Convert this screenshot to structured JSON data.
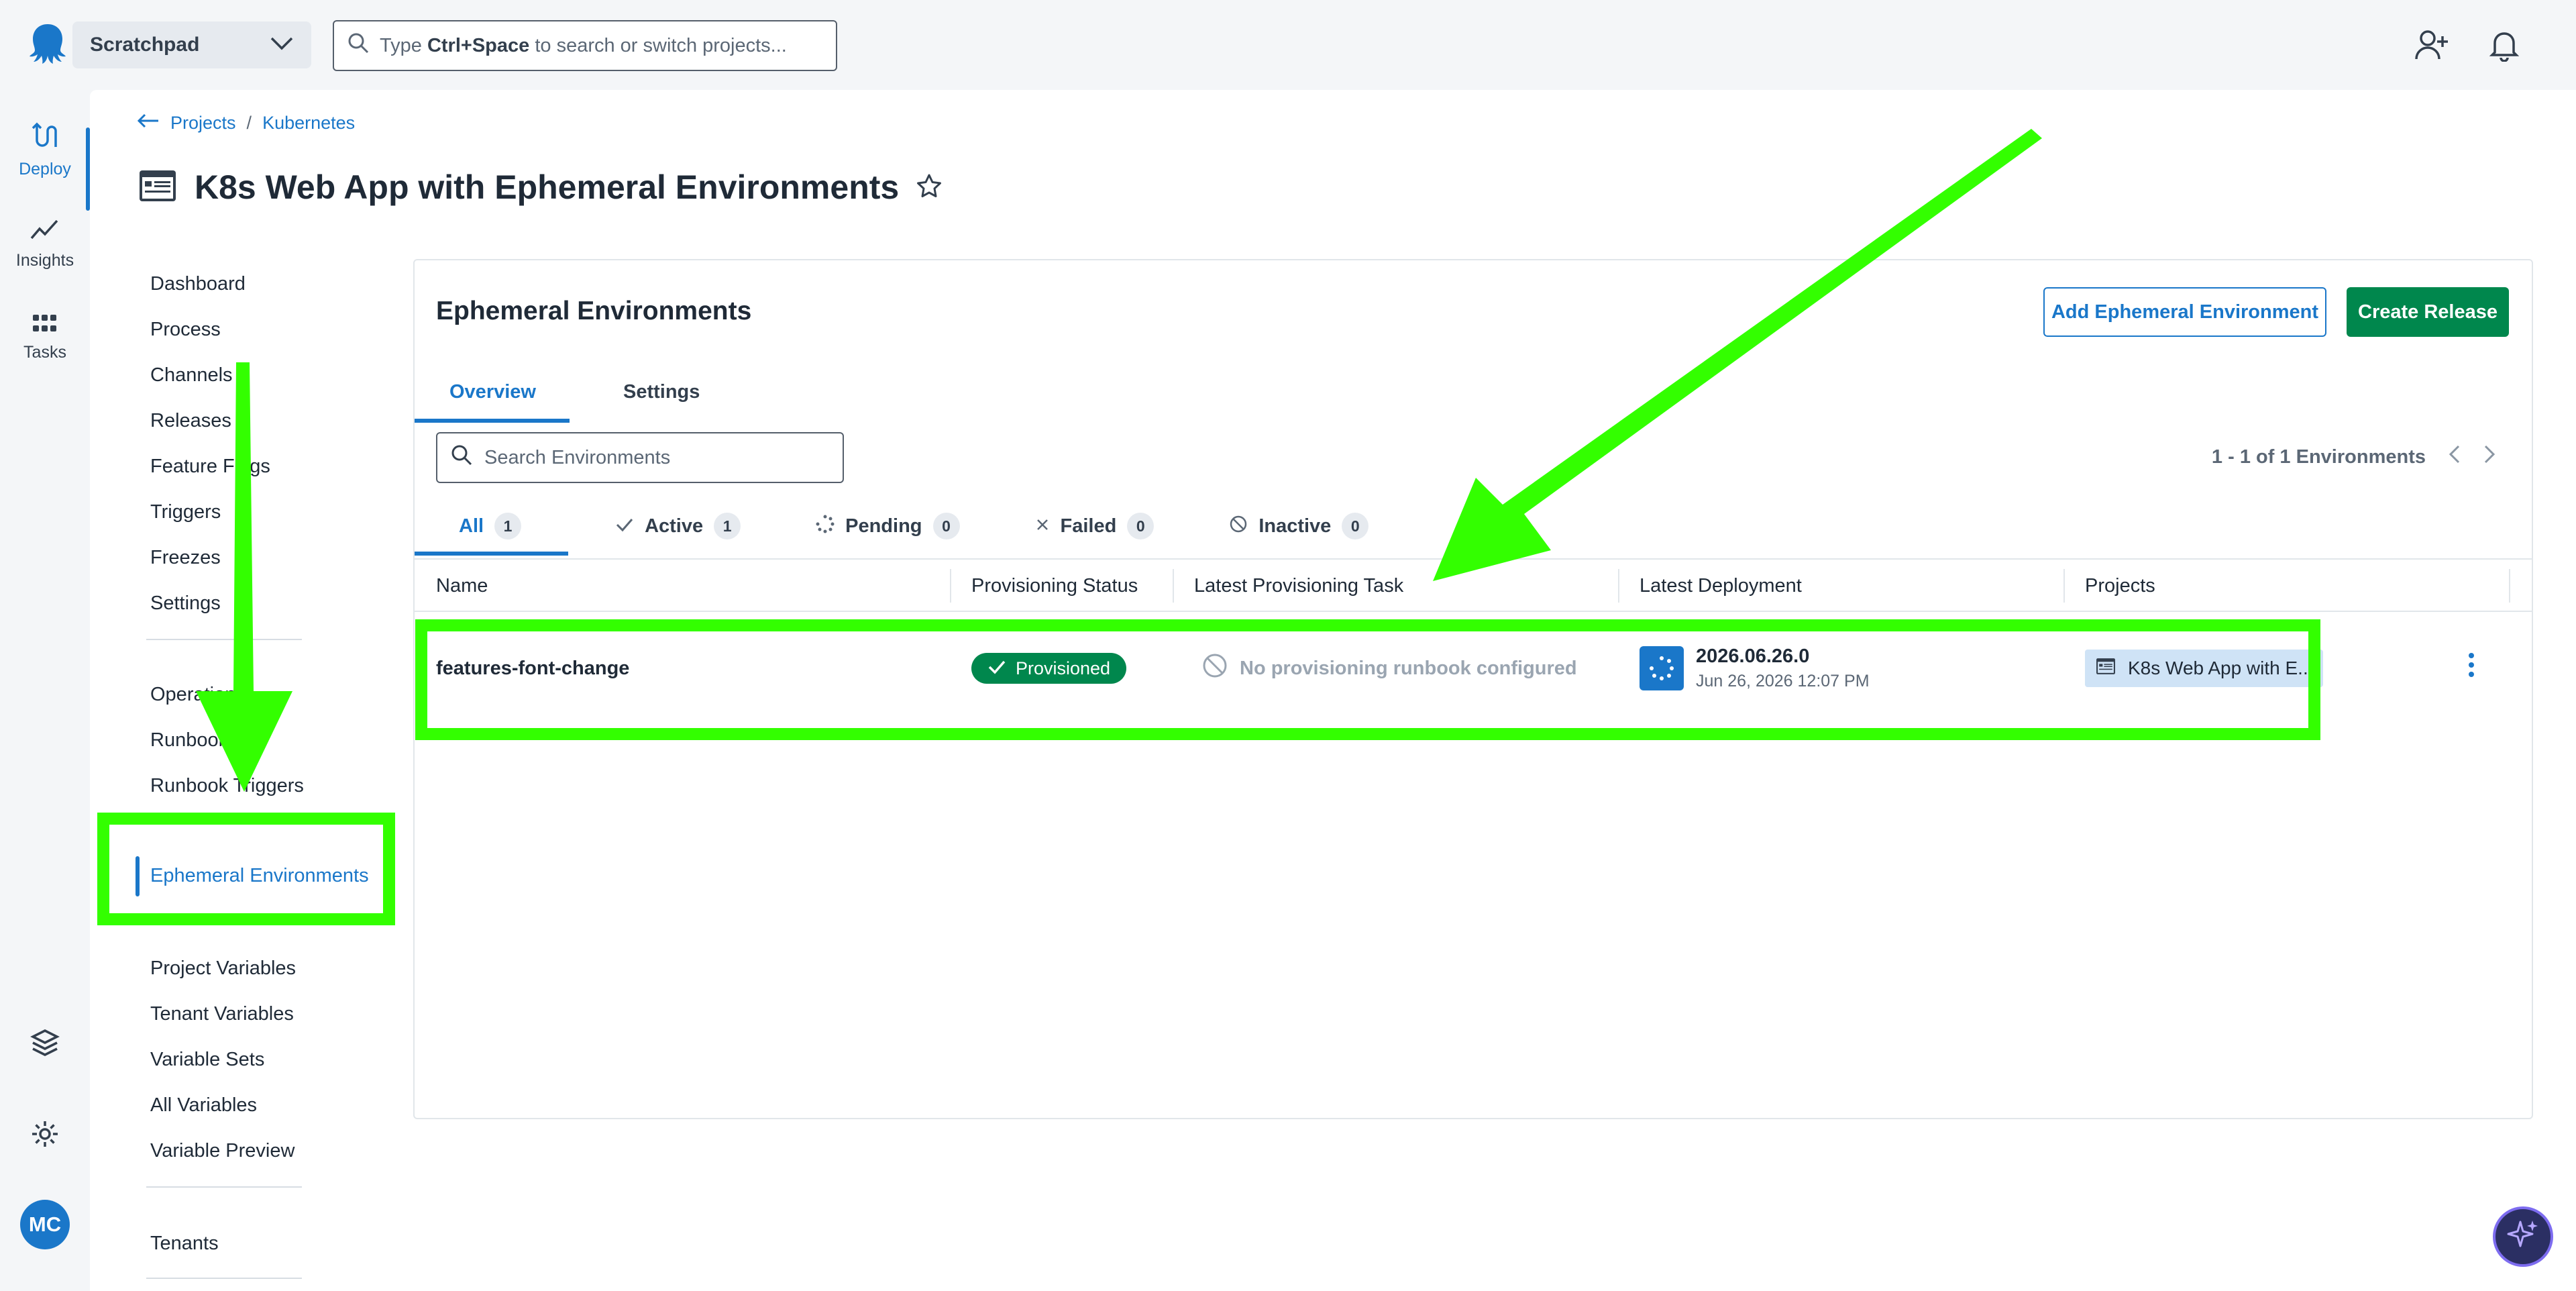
{
  "topbar": {
    "space_name": "Scratchpad",
    "search_prefix": "Type",
    "search_key": "Ctrl+Space",
    "search_suffix": "to search or switch projects..."
  },
  "rail": {
    "items": [
      {
        "label": "Deploy",
        "icon": "deploy-icon"
      },
      {
        "label": "Insights",
        "icon": "insights-icon"
      },
      {
        "label": "Tasks",
        "icon": "tasks-icon"
      }
    ],
    "avatar_initials": "MC"
  },
  "breadcrumb": {
    "projects": "Projects",
    "separator": "/",
    "group": "Kubernetes"
  },
  "page": {
    "title": "K8s Web App with Ephemeral Environments"
  },
  "subnav": {
    "group1": [
      "Dashboard",
      "Process",
      "Channels",
      "Releases",
      "Feature Flags",
      "Triggers",
      "Freezes",
      "Settings"
    ],
    "group2": [
      "Operations",
      "Runbooks",
      "Runbook Triggers"
    ],
    "group3": [
      "Ephemeral Environments"
    ],
    "group4": [
      "Project Variables",
      "Tenant Variables",
      "Variable Sets",
      "All Variables",
      "Variable Preview"
    ],
    "group5": [
      "Tenants"
    ]
  },
  "panel": {
    "title": "Ephemeral Environments",
    "add_button": "Add Ephemeral Environment",
    "create_button": "Create Release",
    "tabs": [
      "Overview",
      "Settings"
    ],
    "search_placeholder": "Search Environments",
    "pager_text": "1 - 1 of 1 Environments",
    "filters": [
      {
        "label": "All",
        "count": "1"
      },
      {
        "label": "Active",
        "count": "1"
      },
      {
        "label": "Pending",
        "count": "0"
      },
      {
        "label": "Failed",
        "count": "0"
      },
      {
        "label": "Inactive",
        "count": "0"
      }
    ],
    "columns": [
      "Name",
      "Provisioning Status",
      "Latest Provisioning Task",
      "Latest Deployment",
      "Projects"
    ],
    "rows": [
      {
        "name": "features-font-change",
        "status": "Provisioned",
        "task": "No provisioning runbook configured",
        "deploy_version": "2026.06.26.0",
        "deploy_date": "Jun 26, 2026 12:07 PM",
        "project": "K8s Web App with E..."
      }
    ]
  },
  "colors": {
    "accent": "#1a77c9",
    "success": "#00874d",
    "annotation": "#33ff00"
  }
}
